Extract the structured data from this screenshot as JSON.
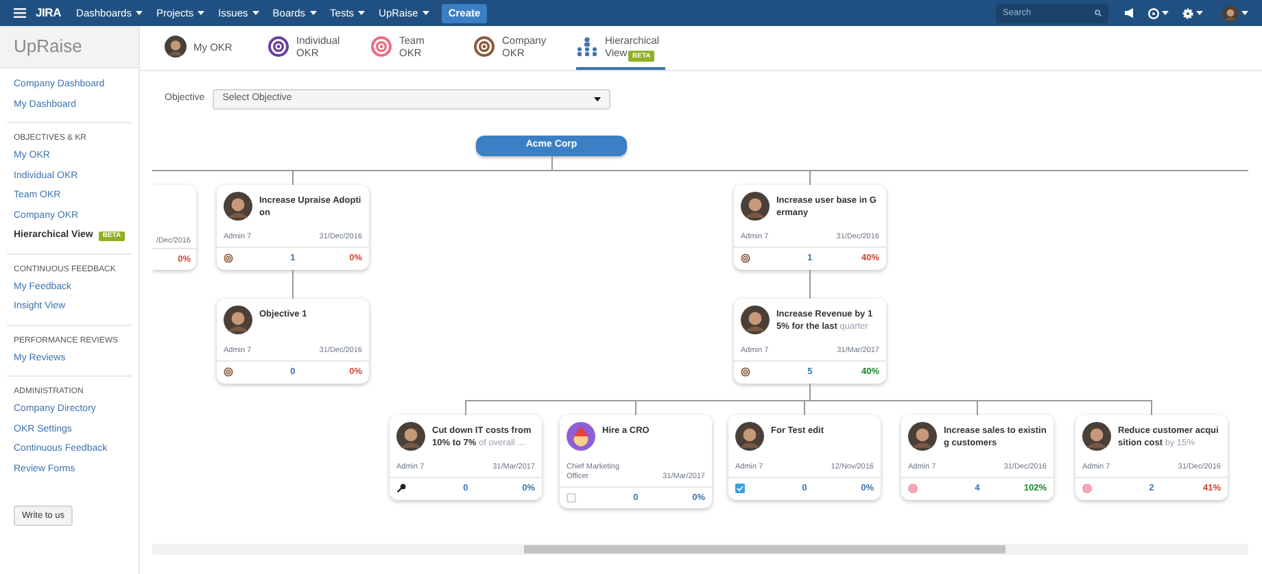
{
  "header": {
    "menus": [
      "Dashboards",
      "Projects",
      "Issues",
      "Boards",
      "Tests",
      "UpRaise"
    ],
    "logo": "JIRA",
    "create": "Create",
    "search_placeholder": "Search"
  },
  "sidebar": {
    "title": "UpRaise",
    "sections": [
      {
        "items": [
          {
            "label": "Company Dashboard",
            "selected": false
          },
          {
            "label": "My Dashboard",
            "selected": false
          }
        ]
      },
      {
        "heading": "OBJECTIVES & KR",
        "items": [
          {
            "label": "My OKR",
            "selected": false
          },
          {
            "label": "Individual OKR",
            "selected": false
          },
          {
            "label": "Team OKR",
            "selected": false
          },
          {
            "label": "Company OKR",
            "selected": false
          },
          {
            "label": "Hierarchical View",
            "selected": true,
            "badge": "BETA"
          }
        ]
      },
      {
        "heading": "CONTINUOUS FEEDBACK",
        "items": [
          {
            "label": "My Feedback",
            "selected": false
          },
          {
            "label": "Insight View",
            "selected": false
          }
        ]
      },
      {
        "heading": "PERFORMANCE REVIEWS",
        "items": [
          {
            "label": "My Reviews",
            "selected": false
          }
        ]
      },
      {
        "heading": "ADMINISTRATION",
        "items": [
          {
            "label": "Company Directory",
            "selected": false
          },
          {
            "label": "OKR Settings",
            "selected": false
          },
          {
            "label": "Continuous Feedback",
            "selected": false
          },
          {
            "label": "Review Forms",
            "selected": false
          }
        ]
      }
    ],
    "button": "Write to us"
  },
  "tabs": [
    {
      "label": "My OKR",
      "kind": "avatar",
      "selected": false
    },
    {
      "label": "Individual OKR",
      "kind": "individual",
      "selected": false
    },
    {
      "label": "Team OKR",
      "kind": "team",
      "selected": false
    },
    {
      "label": "Company OKR",
      "kind": "company",
      "selected": false
    },
    {
      "label": "Hierarchical View",
      "kind": "hierarchy",
      "badge": "BETA",
      "selected": true
    }
  ],
  "filter": {
    "label": "Objective",
    "placeholder": "Select Objective"
  },
  "hierarchy": {
    "root": "Acme Corp",
    "children": [
      {
        "kind": "partial",
        "date": "/Dec/2016",
        "percent": "0%",
        "color": "#d04437"
      },
      {
        "kind": "company",
        "title": "Increase Upraise Adoption",
        "owner": "Admin 7",
        "date": "31/Dec/2016",
        "count": "1",
        "percent": "0%",
        "color": "#d04437",
        "children": [
          {
            "kind": "company",
            "title": "Objective 1",
            "owner": "Admin 7",
            "date": "31/Dec/2016",
            "count": "0",
            "percent": "0%",
            "color": "#d04437"
          }
        ]
      },
      {
        "kind": "company",
        "title": "Increase user base in Germany",
        "owner": "Admin 7",
        "date": "31/Dec/2016",
        "count": "1",
        "percent": "40%",
        "color": "#d04437",
        "children": [
          {
            "kind": "company",
            "title": "Increase Revenue by 15% for the last ",
            "title_faded": "quarter",
            "owner": "Admin 7",
            "date": "31/Mar/2017",
            "count": "5",
            "percent": "40%",
            "color": "#14892c",
            "children": [
              {
                "kind": "key",
                "title": "Cut down IT costs from 10% to 7% ",
                "title_faded": "of overall ...",
                "owner": "Admin 7",
                "date": "31/Mar/2017",
                "count": "0",
                "percent": "0%",
                "color": "#3b73af"
              },
              {
                "kind": "task",
                "title": "Hire a CRO",
                "owner": "Chief Marketing Officer",
                "date": "31/Mar/2017",
                "checked": false,
                "count": "0",
                "percent": "0%",
                "color": "#3b73af"
              },
              {
                "kind": "task",
                "title": "For Test edit",
                "owner": "Admin 7",
                "date": "12/Nov/2016",
                "checked": true,
                "count": "0",
                "percent": "0%",
                "color": "#3b73af"
              },
              {
                "kind": "team",
                "title": "Increase sales to existing customers",
                "owner": "Admin 7",
                "date": "31/Dec/2016",
                "count": "4",
                "percent": "102%",
                "color": "#14892c"
              },
              {
                "kind": "team",
                "title": "Reduce customer acquisition cost ",
                "title_faded": "by 15%",
                "owner": "Admin 7",
                "date": "31/Dec/2016",
                "count": "2",
                "percent": "41%",
                "color": "#d04437"
              }
            ]
          }
        ]
      }
    ]
  }
}
